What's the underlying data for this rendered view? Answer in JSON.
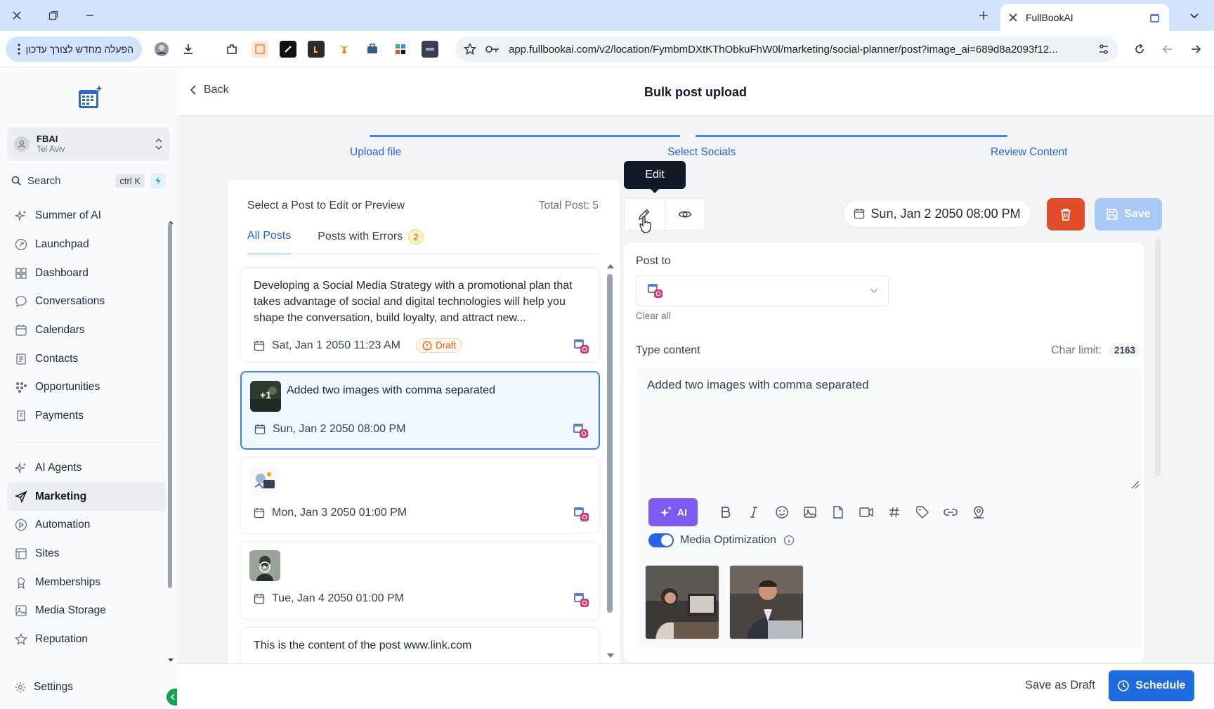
{
  "browser": {
    "tab_title": "FullBookAI",
    "url": "app.fullbookai.com/v2/location/FymbmDXtKThObkuFhW0l/marketing/social-planner/post?image_ai=689d8a2093f12...",
    "update_button": "הפעלה מחדש לצורך עדכון"
  },
  "sidebar": {
    "account_name": "FBAI",
    "account_location": "Tel Aviv",
    "search_placeholder": "Search",
    "search_shortcut": "ctrl K",
    "items": [
      {
        "label": "Summer of AI",
        "icon": "sparkles-icon"
      },
      {
        "label": "Launchpad",
        "icon": "rocket-icon"
      },
      {
        "label": "Dashboard",
        "icon": "grid-icon"
      },
      {
        "label": "Conversations",
        "icon": "chat-icon"
      },
      {
        "label": "Calendars",
        "icon": "calendar-icon"
      },
      {
        "label": "Contacts",
        "icon": "contacts-icon"
      },
      {
        "label": "Opportunities",
        "icon": "funnel-icon"
      },
      {
        "label": "Payments",
        "icon": "receipt-icon"
      }
    ],
    "items2": [
      {
        "label": "AI Agents",
        "icon": "sparkles-icon"
      },
      {
        "label": "Marketing",
        "icon": "send-icon"
      },
      {
        "label": "Automation",
        "icon": "automation-icon"
      },
      {
        "label": "Sites",
        "icon": "globe-icon"
      },
      {
        "label": "Memberships",
        "icon": "membership-icon"
      },
      {
        "label": "Media Storage",
        "icon": "image-icon"
      },
      {
        "label": "Reputation",
        "icon": "star-icon"
      }
    ],
    "settings": "Settings"
  },
  "header": {
    "back": "Back",
    "title": "Bulk post upload"
  },
  "steps": [
    "Upload file",
    "Select Socials",
    "Review Content"
  ],
  "list": {
    "heading": "Select a Post to Edit or Preview",
    "total": "Total Post: 5",
    "tab_all": "All Posts",
    "tab_errors": "Posts with Errors",
    "errors_count": "2",
    "posts": [
      {
        "text": "Developing a Social Media Strategy with a promotional plan that takes advantage of social and digital technologies will help you shape the conversation, build loyalty, and attract new...",
        "date": "Sat, Jan 1 2050 11:23 AM",
        "badge": "Draft"
      },
      {
        "text": "Added two images with comma separated",
        "date": "Sun, Jan 2 2050 08:00 PM",
        "thumb_label": "+1"
      },
      {
        "text": "",
        "date": "Mon, Jan 3 2050 01:00 PM"
      },
      {
        "text": "",
        "date": "Tue, Jan 4 2050 01:00 PM"
      },
      {
        "text": "This is the content of the post www.link.com",
        "date": ""
      }
    ]
  },
  "editor": {
    "tooltip": "Edit",
    "date": "Sun, Jan 2 2050 08:00 PM",
    "save": "Save",
    "post_to_label": "Post to",
    "clear_all": "Clear all",
    "type_content_label": "Type content",
    "char_limit_label": "Char limit:",
    "char_limit_value": "2163",
    "content": "Added two images with comma separated",
    "ai_button": "AI",
    "media_optimization": "Media Optimization",
    "media_optimization_on": true
  },
  "footer": {
    "save_draft": "Save as Draft",
    "schedule": "Schedule"
  },
  "colors": {
    "accent": "#2563eb",
    "danger": "#e14d2a",
    "ai": "#7c5cf0",
    "draft": "#ea580c"
  }
}
